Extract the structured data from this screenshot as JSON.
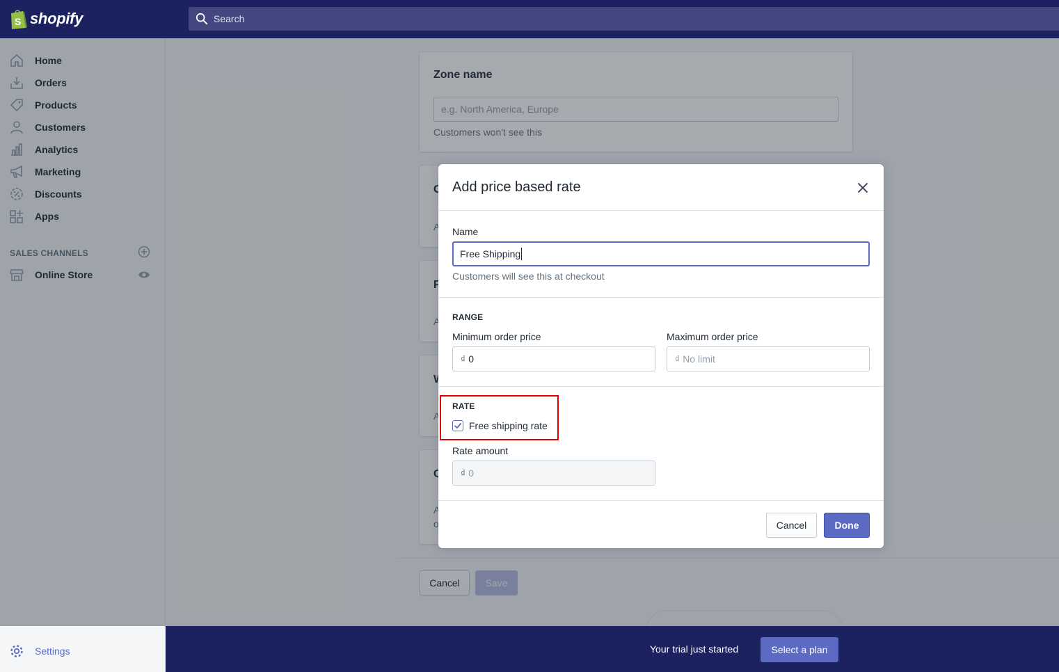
{
  "brand": {
    "name": "shopify"
  },
  "search": {
    "placeholder": "Search"
  },
  "sidebar": {
    "items": [
      {
        "label": "Home"
      },
      {
        "label": "Orders"
      },
      {
        "label": "Products"
      },
      {
        "label": "Customers"
      },
      {
        "label": "Analytics"
      },
      {
        "label": "Marketing"
      },
      {
        "label": "Discounts"
      },
      {
        "label": "Apps"
      }
    ],
    "sales_channels_heading": "SALES CHANNELS",
    "channels": [
      {
        "label": "Online Store"
      }
    ],
    "settings_label": "Settings"
  },
  "zone_card": {
    "title": "Zone name",
    "input_placeholder": "e.g. North America, Europe",
    "help": "Customers won't see this"
  },
  "background_cards": [
    {
      "letter": "C",
      "sub": "A"
    },
    {
      "letter": "P",
      "sub": "A"
    },
    {
      "letter": "W",
      "sub": "A"
    },
    {
      "letter": "C",
      "sub": "A",
      "sub2": "o"
    }
  ],
  "page_actions": {
    "cancel_label": "Cancel",
    "save_label": "Save"
  },
  "modal": {
    "title": "Add price based rate",
    "name_label": "Name",
    "name_value": "Free Shipping",
    "name_help": "Customers will see this at checkout",
    "range_heading": "RANGE",
    "min_label": "Minimum order price",
    "min_currency": "₫",
    "min_value": "0",
    "max_label": "Maximum order price",
    "max_currency": "₫",
    "max_placeholder": "No limit",
    "rate_heading": "RATE",
    "free_rate_label": "Free shipping rate",
    "free_rate_checked": true,
    "rate_amount_label": "Rate amount",
    "rate_amount_currency": "₫",
    "rate_amount_value": "0",
    "cancel_label": "Cancel",
    "done_label": "Done"
  },
  "trial": {
    "text": "Your trial just started",
    "plan_button": "Select a plan"
  },
  "colors": {
    "nav_bg": "#1c2260",
    "accent": "#5c6ac4",
    "highlight": "#e00000"
  }
}
